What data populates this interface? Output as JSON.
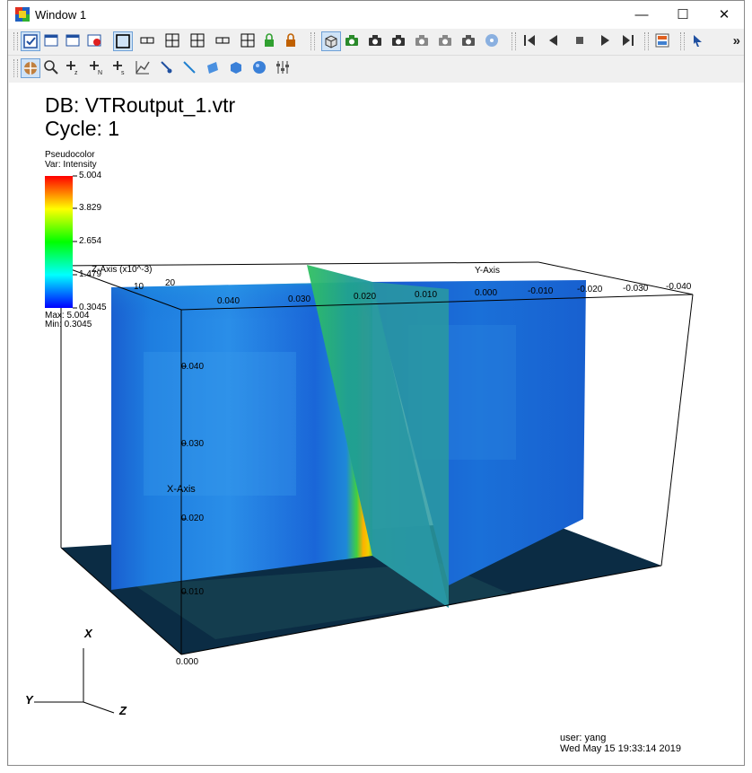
{
  "window": {
    "title": "Window 1",
    "controls": {
      "minimize": "—",
      "maximize": "☐",
      "close": "✕"
    }
  },
  "toolbar1": {
    "icons": [
      "active-window-icon",
      "new-window-icon",
      "clone-window-icon",
      "delete-window-icon",
      "layout-1x1-icon",
      "layout-1x2-icon",
      "layout-2x2-icon",
      "layout-2x3-icon",
      "layout-2x4-icon",
      "layout-3x3-icon",
      "lock-view-icon",
      "lock-time-icon",
      "perspective-icon",
      "spin-icon",
      "camera-icon",
      "camera-save-icon",
      "camera-undo-icon",
      "camera-recent-icon",
      "camera-print-icon",
      "invert-background-icon",
      "step-back-icon",
      "reverse-play-icon",
      "stop-icon",
      "play-icon",
      "step-forward-icon",
      "plot-list-icon",
      "set-cursor-icon"
    ],
    "overflow": "»"
  },
  "toolbar2": {
    "icons": [
      "navigate-icon",
      "zoom-icon",
      "zone-pick-icon",
      "node-pick-icon",
      "spreadsheet-pick-icon",
      "lineout-icon",
      "point-tool-icon",
      "line-tool-icon",
      "plane-tool-icon",
      "box-tool-icon",
      "sphere-tool-icon",
      "axis-restriction-icon"
    ]
  },
  "plot": {
    "db_label": "DB: VTRoutput_1.vtr",
    "cycle_label": "Cycle: 1",
    "legend": {
      "title": "Pseudocolor",
      "var": "Var: Intensity",
      "ticks": [
        "5.004",
        "3.829",
        "2.654",
        "1.479",
        "0.3045"
      ],
      "max": "Max:  5.004",
      "min": "Min:  0.3045"
    },
    "axes": {
      "x_title": "X-Axis",
      "y_title": "Y-Axis",
      "z_title": "Z-Axis (x10^-3)",
      "z_tick": "20",
      "z_tick_small": "10",
      "x_ticks": [
        "0.040",
        "0.030",
        "0.020",
        "0.010",
        "0.000"
      ],
      "y_ticks": [
        "0.040",
        "0.030",
        "0.020",
        "0.010",
        "0.000",
        "-0.010",
        "-0.020",
        "-0.030",
        "-0.040"
      ]
    },
    "triad": {
      "x": "X",
      "y": "Y",
      "z": "Z"
    },
    "user": "user: yang",
    "date": "Wed May 15 19:33:14 2019"
  },
  "colors": {
    "colormap": [
      "#ff0000",
      "#ffff00",
      "#00ff00",
      "#00ffff",
      "#0000ff"
    ],
    "floor": "#0b2c44",
    "slice_blue": "#1e6fd6",
    "slice_hot": "#ffcc00"
  }
}
